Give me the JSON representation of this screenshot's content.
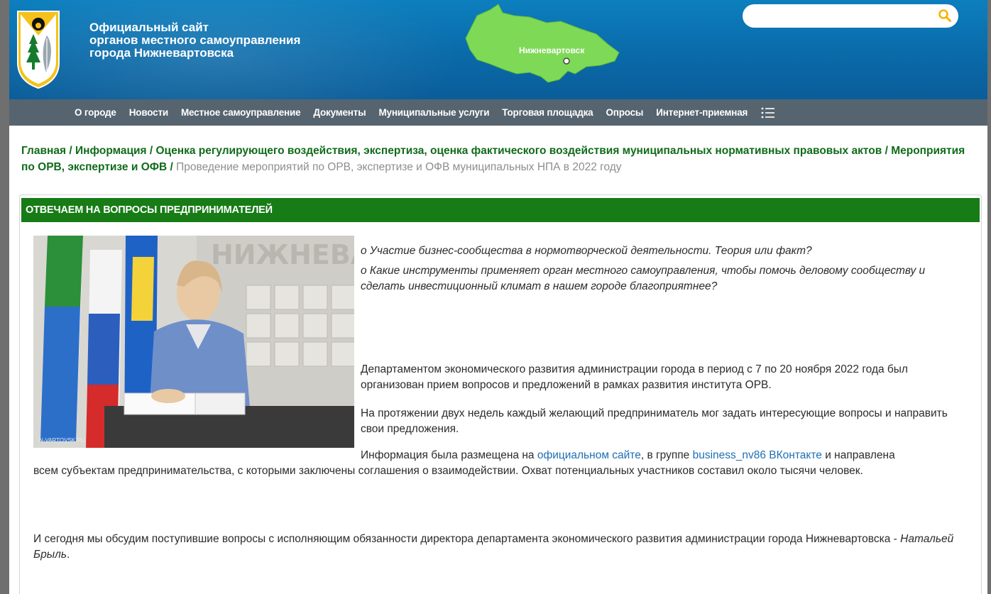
{
  "header": {
    "title_lines": [
      "Официальный сайт",
      "органов местного самоуправления",
      "города Нижневартовска"
    ],
    "map_label": "Нижневартовск",
    "search": {
      "placeholder": "",
      "value": ""
    }
  },
  "nav": {
    "items": [
      "О городе",
      "Новости",
      "Местное самоуправление",
      "Документы",
      "Муниципальные услуги",
      "Торговая площадка",
      "Опросы",
      "Интернет-приемная"
    ]
  },
  "breadcrumb": {
    "items": [
      "Главная",
      "Информация",
      "Оценка регулирующего воздействия, экспертиза, оценка фактического воздействия муниципальных нормативных правовых актов",
      "Мероприятия по ОРВ, экспертизе и ОФВ"
    ],
    "separator": "/",
    "current": "Проведение мероприятий по ОРВ, экспертизе и ОФВ муниципальных НПА в 2022 году"
  },
  "article": {
    "heading": "ОТВЕЧАЕМ НА ВОПРОСЫ ПРЕДПРИНИМАТЕЛЕЙ",
    "photo_credit": "N-VARTOVSK.RU",
    "questions": [
      "о Участие бизнес-сообщества в нормотворческой деятельности. Теория или факт?",
      "о Какие инструменты применяет орган местного самоуправления, чтобы помочь деловому сообществу и сделать инвестиционный климат в нашем городе благоприятнее?"
    ],
    "p1": "Департаментом экономического развития администрации города в период с 7 по 20 ноября 2022 года был организован прием вопросов и предложений в рамках развития института ОРВ.",
    "p2": "На протяжении двух недель каждый желающий предприниматель мог задать интересующие вопросы и направить свои предложения.",
    "p3_before": "Информация была размещена на ",
    "p3_link1": "официальном сайте",
    "p3_middle": ", в группе ",
    "p3_link2": "business_nv86 ВКонтакте",
    "p3_after_line1": " и направлена",
    "p3_rest": "всем субъектам предпринимательства, с которыми заключены соглашения о взаимодействии. Охват потенциальных участников составил около тысячи человек.",
    "p4": "И сегодня мы обсудим поступившие вопросы с исполняющим обязанности директора департамента экономического развития администрации города Нижневартовска - ",
    "p4_name": "Натальей Брыль",
    "p4_end": "."
  },
  "colors": {
    "header_blue": "#0a6aa9",
    "nav_gray": "#56646f",
    "green": "#177b16",
    "breadcrumb_green": "#106b1a",
    "link_blue": "#1e6fb3",
    "search_icon": "#f4b400"
  },
  "icons": {
    "search": "search-icon",
    "menu": "list-menu-icon",
    "crest": "city-crest-logo"
  }
}
